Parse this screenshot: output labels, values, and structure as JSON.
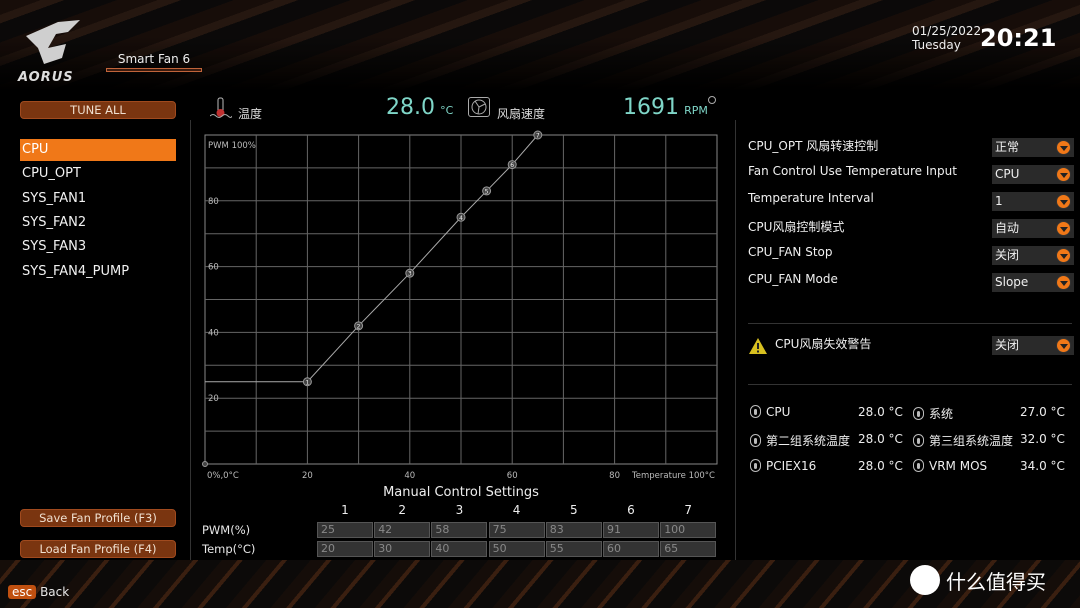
{
  "header": {
    "brand": "AORUS",
    "tab": "Smart Fan 6",
    "date": "01/25/2022",
    "weekday": "Tuesday",
    "time": "20:21"
  },
  "sidebar": {
    "tune_all": "TUNE ALL",
    "items": [
      {
        "label": "CPU",
        "active": true
      },
      {
        "label": "CPU_OPT"
      },
      {
        "label": "SYS_FAN1"
      },
      {
        "label": "SYS_FAN2"
      },
      {
        "label": "SYS_FAN3"
      },
      {
        "label": "SYS_FAN4_PUMP"
      }
    ],
    "save_profile": "Save Fan Profile (F3)",
    "load_profile": "Load Fan Profile (F4)"
  },
  "footer": {
    "esc": "esc",
    "back": "Back",
    "watermark": "什么值得买"
  },
  "monitor": {
    "temp_label": "温度",
    "temp_value": "28.0",
    "temp_unit": "°C",
    "fan_label": "风扇速度",
    "fan_value": "1691",
    "fan_unit": "RPM"
  },
  "chart_data": {
    "type": "line",
    "ylabel": "PWM 100%",
    "xlabel": "Temperature 100°C",
    "origin_label": "0%,0°C",
    "x_ticks": [
      "20",
      "40",
      "60",
      "80"
    ],
    "y_ticks": [
      "20",
      "40",
      "60",
      "80"
    ],
    "xlim": [
      0,
      100
    ],
    "ylim": [
      0,
      100
    ],
    "grid": true,
    "points": [
      {
        "id": "0",
        "temp": 0,
        "pwm": 0
      },
      {
        "id": "1",
        "temp": 20,
        "pwm": 25
      },
      {
        "id": "2",
        "temp": 30,
        "pwm": 42
      },
      {
        "id": "3",
        "temp": 40,
        "pwm": 58
      },
      {
        "id": "4",
        "temp": 50,
        "pwm": 75
      },
      {
        "id": "5",
        "temp": 55,
        "pwm": 83
      },
      {
        "id": "6",
        "temp": 60,
        "pwm": 91
      },
      {
        "id": "7",
        "temp": 65,
        "pwm": 100
      }
    ],
    "line_color": "#aaaaaa"
  },
  "manual": {
    "title": "Manual Control Settings",
    "columns": [
      "1",
      "2",
      "3",
      "4",
      "5",
      "6",
      "7"
    ],
    "pwm_label": "PWM(%)",
    "temp_label": "Temp(°C)",
    "pwm": [
      "25",
      "42",
      "58",
      "75",
      "83",
      "91",
      "100"
    ],
    "temp": [
      "20",
      "30",
      "40",
      "50",
      "55",
      "60",
      "65"
    ]
  },
  "settings": [
    {
      "label": "CPU_OPT 风扇转速控制",
      "value": "正常"
    },
    {
      "label": "Fan Control Use Temperature Input",
      "value": "CPU"
    },
    {
      "label": "Temperature Interval",
      "value": "1"
    },
    {
      "label": "CPU风扇控制模式",
      "value": "自动"
    },
    {
      "label": "CPU_FAN Stop",
      "value": "关闭"
    },
    {
      "label": "CPU_FAN Mode",
      "value": "Slope"
    }
  ],
  "warning": {
    "label": "CPU风扇失效警告",
    "value": "关闭",
    "icon": "warning-icon",
    "color": "#d8c020"
  },
  "temps": [
    {
      "name": "CPU",
      "value": "28.0 °C"
    },
    {
      "name": "系统",
      "value": "27.0 °C"
    },
    {
      "name": "第二组系统温度",
      "value": "28.0 °C"
    },
    {
      "name": "第三组系统温度",
      "value": "32.0 °C"
    },
    {
      "name": "PCIEX16",
      "value": "28.0 °C"
    },
    {
      "name": "VRM MOS",
      "value": "34.0 °C"
    }
  ],
  "colors": {
    "accent": "#f07818",
    "button": "#7a3510",
    "readout": "#7fd6c8"
  }
}
